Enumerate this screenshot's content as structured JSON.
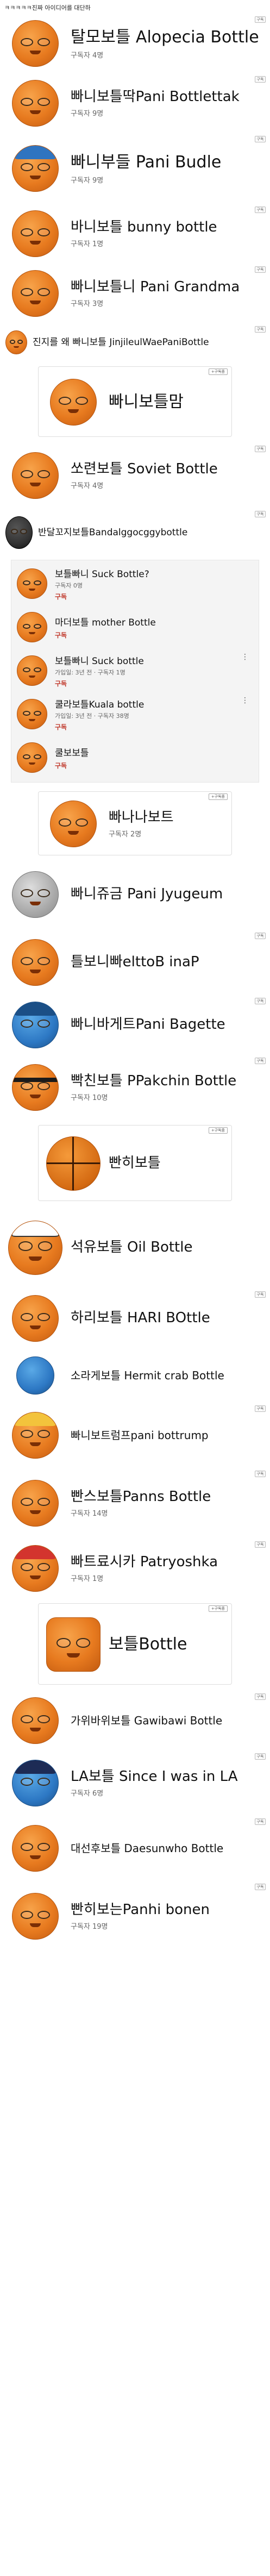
{
  "header": {
    "title": "ㅋㅋㅋㅋㅋ진짜 아이디어를 대단하"
  },
  "labels": {
    "subscribe": "구독",
    "subscribe_tag": "+구독중"
  },
  "channels": [
    {
      "name": "탈모보틀 Alopecia Bottle",
      "subs": "구독자 4명"
    },
    {
      "name": "빠니보틀딱Pani Bottlettak",
      "subs": "구독자 9명"
    },
    {
      "name": "빠니부들 Pani Budle",
      "subs": "구독자 9명"
    },
    {
      "name": "바니보틀 bunny bottle",
      "subs": "구독자 1명"
    },
    {
      "name": "빠니보틀니 Pani Grandma",
      "subs": "구독자 3명"
    },
    {
      "name": "진지를 왜 빠니보틀 JinjileulWaePaniBottle",
      "subs": ""
    },
    {
      "name": "빠니보틀맘",
      "subs": ""
    },
    {
      "name": "쏘련보틀 Soviet Bottle",
      "subs": "구독자 4명"
    },
    {
      "name": "반달꼬지보틀Bandalggocggybottle",
      "subs": ""
    },
    {
      "name": "빠나나보트",
      "subs": "구독자 2명"
    },
    {
      "name": "빠니쥬금 Pani Jyugeum",
      "subs": ""
    },
    {
      "name": "틀보니빠elttoB inaP",
      "subs": ""
    },
    {
      "name": "빠니바게트Pani Bagette",
      "subs": ""
    },
    {
      "name": "빡친보틀 PPakchin Bottle",
      "subs": "구독자 10명"
    },
    {
      "name": "빤히보틀",
      "subs": ""
    },
    {
      "name": "석유보틀 Oil Bottle",
      "subs": ""
    },
    {
      "name": "하리보틀 HARI BOttle",
      "subs": ""
    },
    {
      "name": "소라게보틀 Hermit crab Bottle",
      "subs": ""
    },
    {
      "name": "빠니보트럼프pani bottrump",
      "subs": ""
    },
    {
      "name": "빤스보틀Panns Bottle",
      "subs": "구독자 14명"
    },
    {
      "name": "빠트료시카 Patryoshka",
      "subs": "구독자 1명"
    },
    {
      "name": "보틀Bottle",
      "subs": ""
    },
    {
      "name": "가위바위보틀 Gawibawi Bottle",
      "subs": ""
    },
    {
      "name": "LA보틀 Since I was in LA",
      "subs": "구독자 6명"
    },
    {
      "name": "대선후보틀 Daesunwho Bottle",
      "subs": ""
    },
    {
      "name": "빤히보는Panhi bonen",
      "subs": "구독자 19명"
    }
  ],
  "list_box": [
    {
      "title": "보틀빠니 Suck Bottle?",
      "sub": "구독자 0명",
      "action": "구독"
    },
    {
      "title": "마더보틀 mother Bottle",
      "sub": "",
      "action": "구독"
    },
    {
      "title": "보틀빠니 Suck bottle",
      "sub": "가입일: 3년 전 · 구독자 1명",
      "action": "구독"
    },
    {
      "title": "쿨라보틀Kuala bottle",
      "sub": "가입일: 3년 전 · 구독자 38명",
      "action": "구독"
    },
    {
      "title": "쿨보보틀",
      "sub": "",
      "action": "구독"
    }
  ]
}
